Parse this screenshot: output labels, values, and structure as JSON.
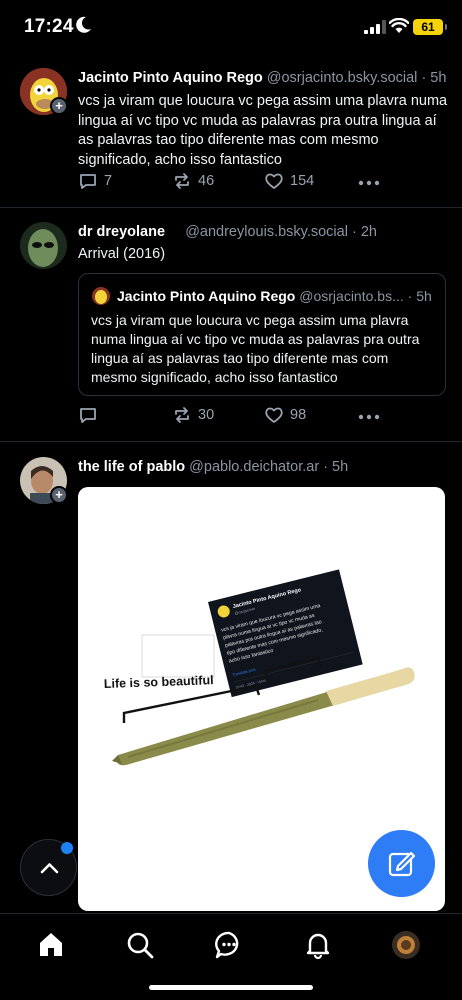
{
  "status_bar": {
    "time": "17:24",
    "battery": "61"
  },
  "posts": [
    {
      "name": "Jacinto Pinto Aquino Rego",
      "handle": "@osrjacinto.bsky.social",
      "time": "· 5h",
      "text": "vcs ja viram que loucura vc pega assim uma plavra numa lingua aí vc tipo vc muda as palavras pra outra lingua aí as palavras tao tipo diferente mas com mesmo significado, acho isso fantastico",
      "replies": "7",
      "reposts": "46",
      "likes": "154"
    },
    {
      "name": "dr dreyolane",
      "handle": "@andreylouis.bsky.social",
      "time": "· 2h",
      "text": "Arrival (2016)",
      "quote": {
        "name": "Jacinto Pinto Aquino Rego",
        "handle": "@osrjacinto.bs...",
        "time": "· 5h",
        "text": "vcs ja viram que loucura vc pega assim uma plavra numa lingua aí vc tipo vc muda as palavras pra outra lingua aí as palavras tao tipo diferente mas com mesmo significado, acho isso fantastico"
      },
      "replies": "",
      "reposts": "30",
      "likes": "98"
    },
    {
      "name": "the life of pablo",
      "handle": "@pablo.deichator.ar",
      "time": "· 5h",
      "media": {
        "caption": "Life is so beautiful",
        "screenshot_name": "Jacinto Pinto Aquino Rego",
        "screenshot_text": "vcs ja viram que loucura vc pega assim uma plavra numa lingua aí vc tipo vc muda as palavras pra outra lingua aí as palavras tao tipo diferente mas com mesmo significado, acho isso fantastico"
      }
    }
  ],
  "colors": {
    "accent": "#2e7cf6",
    "muted": "#8b95a3",
    "background": "#000000"
  }
}
